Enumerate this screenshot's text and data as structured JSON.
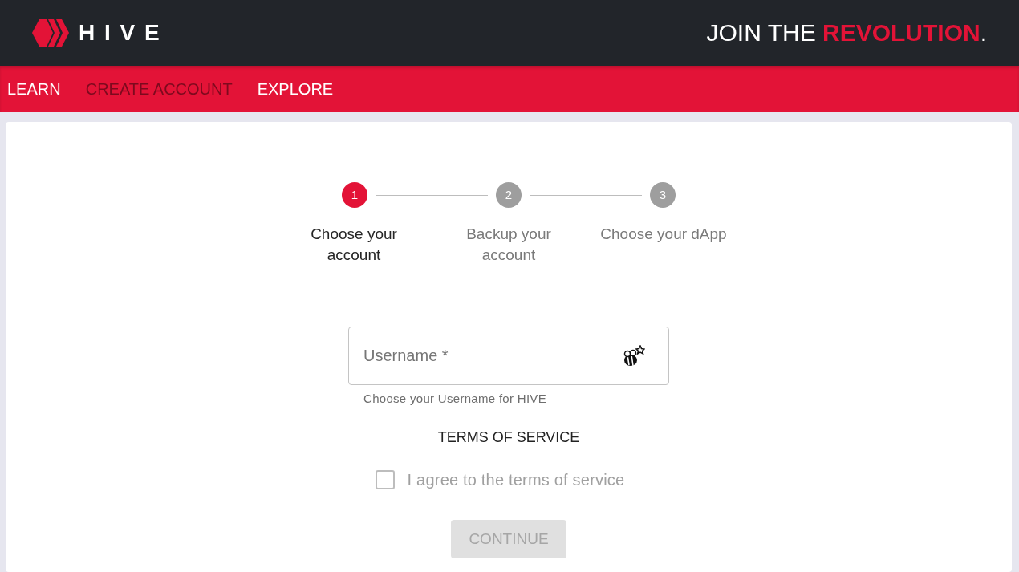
{
  "header": {
    "logo_text": "HIVE",
    "tagline": [
      {
        "text": "JOIN THE ",
        "accent": false
      },
      {
        "text": "REVOLUTION",
        "accent": true
      },
      {
        "text": ".",
        "accent": false
      }
    ]
  },
  "nav": {
    "items": [
      {
        "label": "LEARN",
        "selected": false
      },
      {
        "label": "CREATE ACCOUNT",
        "selected": true
      },
      {
        "label": "EXPLORE",
        "selected": false
      }
    ]
  },
  "stepper": {
    "steps": [
      {
        "number": "1",
        "label": "Choose your account",
        "active": true
      },
      {
        "number": "2",
        "label": "Backup your account",
        "active": false
      },
      {
        "number": "3",
        "label": "Choose your dApp",
        "active": false
      }
    ]
  },
  "username_field": {
    "placeholder": "Username *",
    "helper": "Choose your Username for HIVE"
  },
  "terms": {
    "heading": "TERMS OF SERVICE",
    "agree_label": "I agree to the terms of service",
    "checked": false,
    "disabled": true
  },
  "continue_button": {
    "label": "CONTINUE",
    "disabled": true
  }
}
